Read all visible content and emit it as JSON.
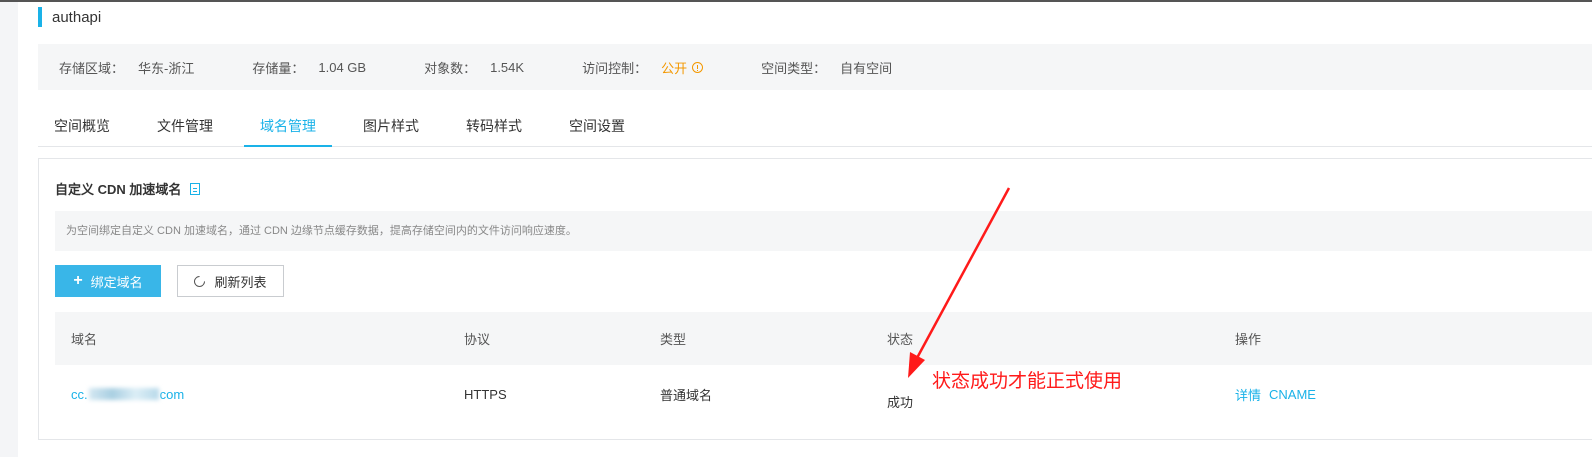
{
  "title": "authapi",
  "info": {
    "region_label": "存储区域：",
    "region_value": "华东-浙江",
    "storage_label": "存储量：",
    "storage_value": "1.04 GB",
    "objects_label": "对象数：",
    "objects_value": "1.54K",
    "access_label": "访问控制：",
    "access_value": "公开",
    "type_label": "空间类型：",
    "type_value": "自有空间"
  },
  "tabs": [
    {
      "label": "空间概览"
    },
    {
      "label": "文件管理"
    },
    {
      "label": "域名管理"
    },
    {
      "label": "图片样式"
    },
    {
      "label": "转码样式"
    },
    {
      "label": "空间设置"
    }
  ],
  "panel": {
    "title": "自定义 CDN 加速域名",
    "notice": "为空间绑定自定义 CDN 加速域名，通过 CDN 边缘节点缓存数据，提高存储空间内的文件访问响应速度。",
    "bind_button": "绑定域名",
    "refresh_button": "刷新列表"
  },
  "table": {
    "headers": [
      "域名",
      "协议",
      "类型",
      "状态",
      "操作"
    ],
    "rows": [
      {
        "domain_prefix": "cc.",
        "domain_suffix": "com",
        "protocol": "HTTPS",
        "type": "普通域名",
        "status": "成功",
        "action_detail": "详情",
        "action_cname": "CNAME"
      }
    ]
  },
  "annotation": {
    "text": "状态成功才能正式使用",
    "color": "#ff1a1a"
  },
  "colors": {
    "accent": "#1ab2e8",
    "warning": "#f39800",
    "primary_button": "#39b6e8"
  }
}
